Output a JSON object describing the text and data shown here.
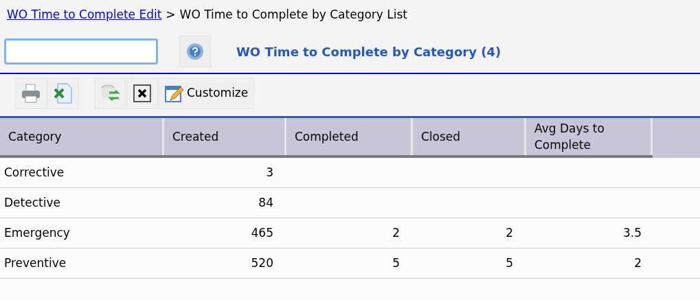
{
  "breadcrumb": {
    "link": "WO Time to Complete Edit",
    "separator": ">",
    "current": "WO Time to Complete by Category List"
  },
  "title": "WO Time to Complete by Category (4)",
  "toolbar": {
    "customize": "Customize"
  },
  "table": {
    "columns": [
      "Category",
      "Created",
      "Completed",
      "Closed",
      "Avg Days to Complete"
    ],
    "rows": [
      {
        "cells": [
          "Corrective",
          "3",
          "",
          "",
          ""
        ]
      },
      {
        "cells": [
          "Detective",
          "84",
          "",
          "",
          ""
        ]
      },
      {
        "cells": [
          "Emergency",
          "465",
          "2",
          "2",
          "3.5"
        ]
      },
      {
        "cells": [
          "Preventive",
          "520",
          "5",
          "5",
          "2"
        ]
      }
    ]
  }
}
